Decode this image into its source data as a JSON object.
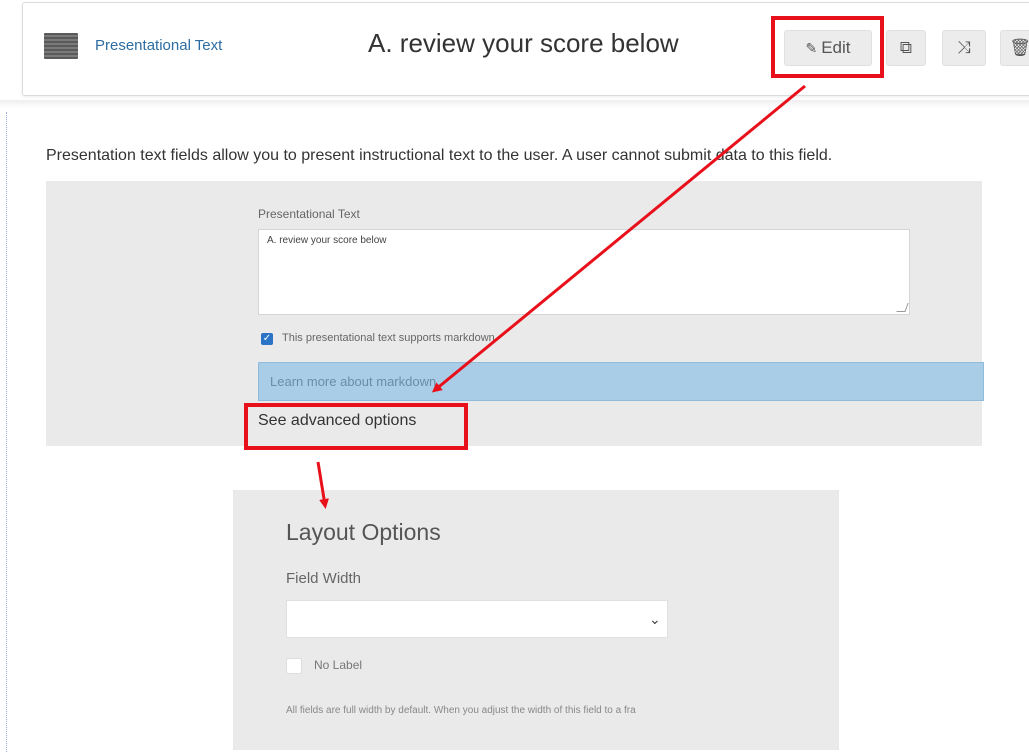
{
  "header": {
    "field_type": "Presentational Text",
    "title": "A. review your score below",
    "edit_label": "Edit",
    "copy_icon": "copy-icon",
    "shuffle_icon": "shuffle-icon",
    "delete_icon": "trash-icon"
  },
  "main": {
    "description": "Presentation text fields allow you to present instructional text to the user. A user cannot submit data to this field.",
    "pt_label": "Presentational Text",
    "pt_value": "A. review your score below",
    "markdown_label": "This presentational text supports markdown",
    "markdown_checked": true,
    "learn_more": "Learn more about markdown",
    "advanced_link": "See advanced options"
  },
  "layout": {
    "title": "Layout Options",
    "field_width_label": "Field Width",
    "field_width_value": "",
    "no_label": "No Label",
    "help": "All fields are full width by default. When you adjust the width of this field to a fra"
  },
  "colors": {
    "annotation_red": "#e8101a",
    "link_blue": "#2d6da3",
    "info_bar": "#a9cde6"
  }
}
